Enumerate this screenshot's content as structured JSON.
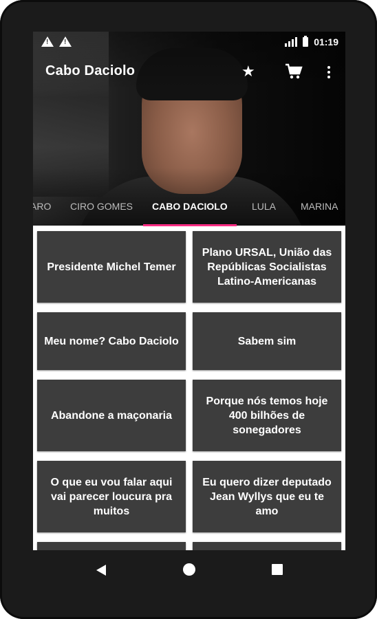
{
  "status_bar": {
    "time": "01:19",
    "warning_icons": [
      "warning-icon",
      "warning-icon"
    ],
    "signal_icon": "signal-icon",
    "battery_icon": "battery-icon"
  },
  "toolbar": {
    "title": "Cabo Daciolo",
    "favorite_icon": "star-icon",
    "cart_icon": "cart-icon",
    "menu_icon": "more-vert-icon"
  },
  "tabs": [
    {
      "label": "ARO",
      "active": false
    },
    {
      "label": "CIRO GOMES",
      "active": false
    },
    {
      "label": "CABO DACIOLO",
      "active": true
    },
    {
      "label": "LULA",
      "active": false
    },
    {
      "label": "MARINA",
      "active": false
    }
  ],
  "colors": {
    "accent": "#ff2d84",
    "card": "#3d3d3d",
    "device": "#1b1b1b"
  },
  "sound_buttons": [
    "Presidente Michel Temer",
    "Plano URSAL, União das Repúblicas Socialistas Latino-Americanas",
    "Meu nome? Cabo Daciolo",
    "Sabem sim",
    "Abandone a maçonaria",
    "Porque nós temos hoje 400 bilhões de sonegadores",
    "O que eu vou falar aqui vai parecer loucura pra muitos",
    "Eu quero dizer deputado Jean Wyllys que eu te amo"
  ],
  "nav_bar": {
    "back_icon": "back-icon",
    "home_icon": "home-icon",
    "recents_icon": "recents-icon"
  }
}
